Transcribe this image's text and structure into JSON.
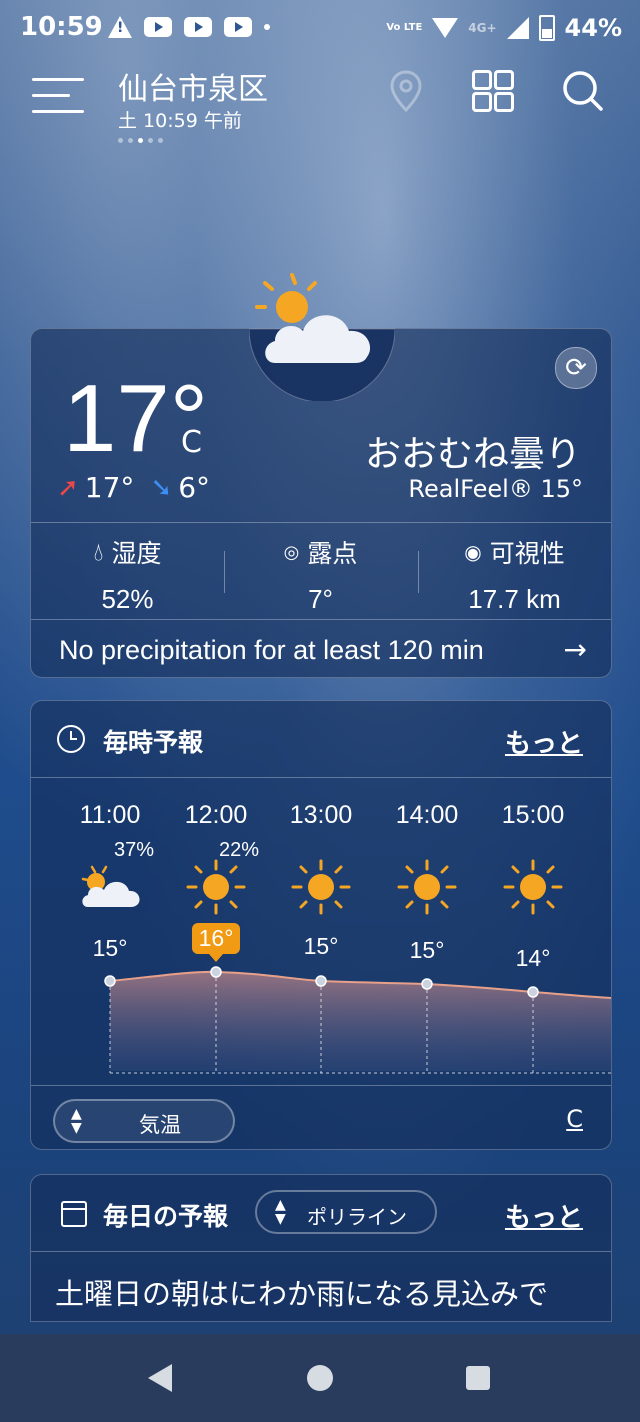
{
  "status_bar": {
    "time": "10:59",
    "battery": "44%",
    "network": "4G+",
    "volte": "Vo LTE"
  },
  "app_bar": {
    "city": "仙台市泉区",
    "datetime": "土 10:59 午前"
  },
  "current": {
    "temperature": "17°",
    "unit": "C",
    "high": "17°",
    "low": "6°",
    "condition": "おおむね曇り",
    "realfeel": "RealFeel® 15°",
    "stats": [
      {
        "icon": "humidity-icon",
        "label": "湿度",
        "value": "52%"
      },
      {
        "icon": "dew-point-icon",
        "label": "露点",
        "value": "7°"
      },
      {
        "icon": "visibility-icon",
        "label": "可視性",
        "value": "17.7 km"
      }
    ],
    "precipitation": "No precipitation for at least 120 min"
  },
  "hourly": {
    "title": "毎時予報",
    "more": "もっと",
    "metric": "気温",
    "unit_link": "C",
    "hours": [
      {
        "time": "11:00",
        "pop": "37%",
        "icon": "partly-cloudy-icon",
        "temp": "15°"
      },
      {
        "time": "12:00",
        "pop": "22%",
        "icon": "sunny-icon",
        "temp": "16°"
      },
      {
        "time": "13:00",
        "pop": "",
        "icon": "sunny-icon",
        "temp": "15°"
      },
      {
        "time": "14:00",
        "pop": "",
        "icon": "sunny-icon",
        "temp": "15°"
      },
      {
        "time": "15:00",
        "pop": "",
        "icon": "sunny-icon",
        "temp": "14°"
      }
    ]
  },
  "daily": {
    "title": "毎日の予報",
    "format": "ポリライン",
    "more": "もっと",
    "summary": "土曜日の朝はにわか雨になる見込みで"
  },
  "colors": {
    "highlight": "#f19a13",
    "sun": "#f5a623",
    "high_arrow": "#ef4747",
    "low_arrow": "#3d8ef5"
  }
}
